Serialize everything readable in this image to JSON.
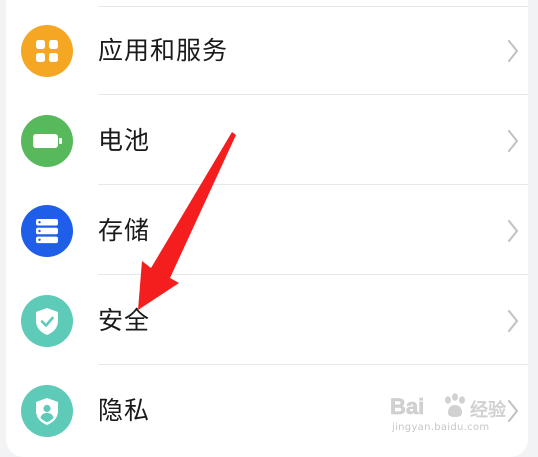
{
  "settings": {
    "items": [
      {
        "label": "应用和服务",
        "icon": "apps-grid-icon",
        "color": "#F5A623"
      },
      {
        "label": "电池",
        "icon": "battery-icon",
        "color": "#58B85C"
      },
      {
        "label": "存储",
        "icon": "storage-icon",
        "color": "#1E5EE8"
      },
      {
        "label": "安全",
        "icon": "shield-check-icon",
        "color": "#5ECBB8"
      },
      {
        "label": "隐私",
        "icon": "privacy-shield-icon",
        "color": "#5ECBB8"
      }
    ]
  },
  "annotation": {
    "arrow_color": "#F41E1E"
  },
  "watermark": {
    "brand": "Bai",
    "word": "经验",
    "url": "jingyan.baidu.com"
  }
}
